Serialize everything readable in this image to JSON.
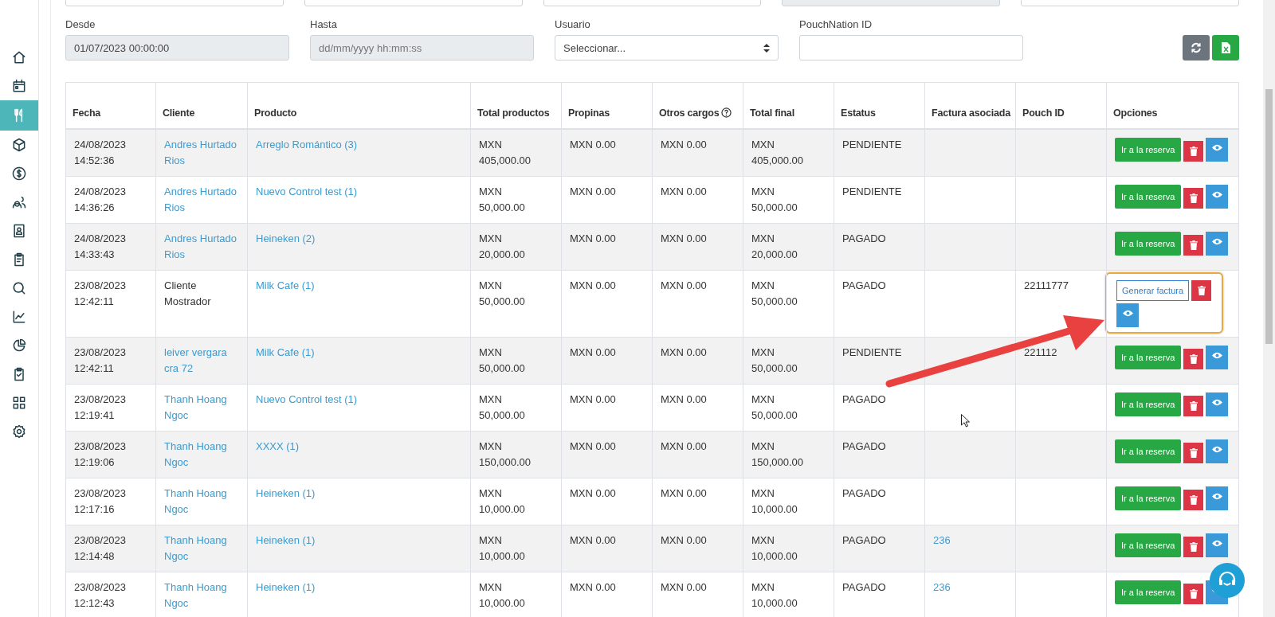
{
  "sidebar": {
    "items": [
      {
        "selected": false
      },
      {
        "selected": false
      },
      {
        "selected": true
      },
      {
        "selected": false
      },
      {
        "selected": false
      },
      {
        "selected": false
      },
      {
        "selected": false
      },
      {
        "selected": false
      },
      {
        "selected": false
      },
      {
        "selected": false
      },
      {
        "selected": false
      },
      {
        "selected": false
      },
      {
        "selected": false
      },
      {
        "selected": false
      }
    ]
  },
  "top_fields": [
    {
      "disabled": false
    },
    {
      "disabled": false
    },
    {
      "disabled": false
    },
    {
      "disabled": true
    },
    {
      "disabled": false
    }
  ],
  "filters": [
    {
      "kind": "input",
      "label": "Desde",
      "value": "01/07/2023 00:00:00",
      "disabled": true
    },
    {
      "kind": "input",
      "label": "Hasta",
      "placeholder": "dd/mm/yyyy hh:mm:ss",
      "disabled": true
    },
    {
      "kind": "select",
      "label": "Usuario",
      "value": "Seleccionar...",
      "disabled": false
    },
    {
      "kind": "input",
      "label": "PouchNation ID",
      "disabled": false
    }
  ],
  "columns": [
    {
      "label": "Fecha",
      "info": false
    },
    {
      "label": "Cliente",
      "info": false
    },
    {
      "label": "Producto",
      "info": false
    },
    {
      "label": "Total productos",
      "info": false
    },
    {
      "label": "Propinas",
      "info": false
    },
    {
      "label": "Otros cargos",
      "info": true
    },
    {
      "label": "Total final",
      "info": false
    },
    {
      "label": "Estatus",
      "info": false
    },
    {
      "label": "Factura asociada",
      "info": false
    },
    {
      "label": "Pouch ID",
      "info": false
    },
    {
      "label": "Opciones",
      "info": false
    }
  ],
  "rows": [
    {
      "date": "24/08/2023 14:52:36",
      "client": "Andres Hurtado Rios",
      "client_link": true,
      "product": "Arreglo Romántico (3)",
      "total_products": "MXN 405,000.00",
      "tips": "MXN 0.00",
      "other": "MXN 0.00",
      "total": "MXN 405,000.00",
      "status": "PENDIENTE",
      "invoice": "",
      "pouch_id": "",
      "action": {
        "kind": "reserva",
        "label": "Ir a la reserva"
      },
      "highlighted": false
    },
    {
      "date": "24/08/2023 14:36:26",
      "client": "Andres Hurtado Rios",
      "client_link": true,
      "product": "Nuevo Control test (1)",
      "total_products": "MXN 50,000.00",
      "tips": "MXN 0.00",
      "other": "MXN 0.00",
      "total": "MXN 50,000.00",
      "status": "PENDIENTE",
      "invoice": "",
      "pouch_id": "",
      "action": {
        "kind": "reserva",
        "label": "Ir a la reserva"
      },
      "highlighted": false
    },
    {
      "date": "24/08/2023 14:33:43",
      "client": "Andres Hurtado Rios",
      "client_link": true,
      "product": "Heineken (2)",
      "total_products": "MXN 20,000.00",
      "tips": "MXN 0.00",
      "other": "MXN 0.00",
      "total": "MXN 20,000.00",
      "status": "PAGADO",
      "invoice": "",
      "pouch_id": "",
      "action": {
        "kind": "reserva",
        "label": "Ir a la reserva"
      },
      "highlighted": false
    },
    {
      "date": "23/08/2023 12:42:11",
      "client": "Cliente Mostrador",
      "client_link": false,
      "product": "Milk Cafe (1)",
      "total_products": "MXN 50,000.00",
      "tips": "MXN 0.00",
      "other": "MXN 0.00",
      "total": "MXN 50,000.00",
      "status": "PAGADO",
      "invoice": "",
      "pouch_id": "22111777",
      "action": {
        "kind": "factura",
        "label": "Generar factura"
      },
      "highlighted": true
    },
    {
      "date": "23/08/2023 12:42:11",
      "client": "leiver vergara cra 72",
      "client_link": true,
      "product": "Milk Cafe (1)",
      "total_products": "MXN 50,000.00",
      "tips": "MXN 0.00",
      "other": "MXN 0.00",
      "total": "MXN 50,000.00",
      "status": "PENDIENTE",
      "invoice": "",
      "pouch_id": "221112",
      "action": {
        "kind": "reserva",
        "label": "Ir a la reserva"
      },
      "highlighted": false
    },
    {
      "date": "23/08/2023 12:19:41",
      "client": "Thanh Hoang Ngoc",
      "client_link": true,
      "product": "Nuevo Control test (1)",
      "total_products": "MXN 50,000.00",
      "tips": "MXN 0.00",
      "other": "MXN 0.00",
      "total": "MXN 50,000.00",
      "status": "PAGADO",
      "invoice": "",
      "pouch_id": "",
      "action": {
        "kind": "reserva",
        "label": "Ir a la reserva"
      },
      "highlighted": false
    },
    {
      "date": "23/08/2023 12:19:06",
      "client": "Thanh Hoang Ngoc",
      "client_link": true,
      "product": "XXXX (1)",
      "total_products": "MXN 150,000.00",
      "tips": "MXN 0.00",
      "other": "MXN 0.00",
      "total": "MXN 150,000.00",
      "status": "PAGADO",
      "invoice": "",
      "pouch_id": "",
      "action": {
        "kind": "reserva",
        "label": "Ir a la reserva"
      },
      "highlighted": false
    },
    {
      "date": "23/08/2023 12:17:16",
      "client": "Thanh Hoang Ngoc",
      "client_link": true,
      "product": "Heineken (1)",
      "total_products": "MXN 10,000.00",
      "tips": "MXN 0.00",
      "other": "MXN 0.00",
      "total": "MXN 10,000.00",
      "status": "PAGADO",
      "invoice": "",
      "pouch_id": "",
      "action": {
        "kind": "reserva",
        "label": "Ir a la reserva"
      },
      "highlighted": false
    },
    {
      "date": "23/08/2023 12:14:48",
      "client": "Thanh Hoang Ngoc",
      "client_link": true,
      "product": "Heineken (1)",
      "total_products": "MXN 10,000.00",
      "tips": "MXN 0.00",
      "other": "MXN 0.00",
      "total": "MXN 10,000.00",
      "status": "PAGADO",
      "invoice": "236",
      "pouch_id": "",
      "action": {
        "kind": "reserva",
        "label": "Ir a la reserva"
      },
      "highlighted": false
    },
    {
      "date": "23/08/2023 12:12:43",
      "client": "Thanh Hoang Ngoc",
      "client_link": true,
      "product": "Heineken (1)",
      "total_products": "MXN 10,000.00",
      "tips": "MXN 0.00",
      "other": "MXN 0.00",
      "total": "MXN 10,000.00",
      "status": "PAGADO",
      "invoice": "236",
      "pouch_id": "",
      "action": {
        "kind": "reserva",
        "label": "Ir a la reserva"
      },
      "highlighted": false
    }
  ]
}
